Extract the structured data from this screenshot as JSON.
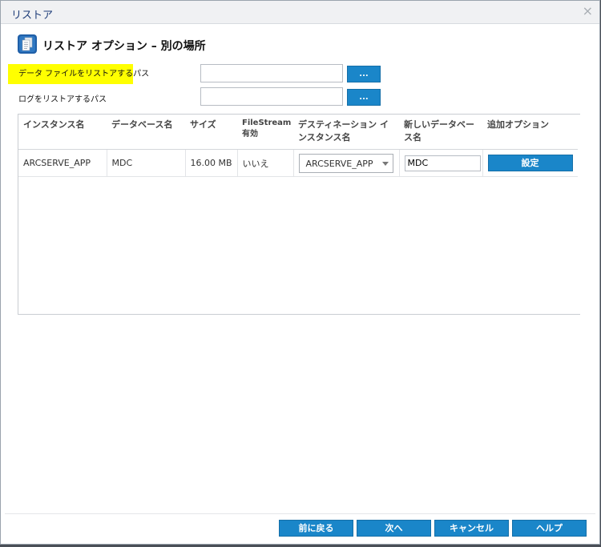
{
  "window": {
    "title": "リストア",
    "close_glyph": "×"
  },
  "header": {
    "icon": "document-icon",
    "title": "リストア オプション – 別の場所"
  },
  "paths": {
    "data_label": "データ ファイルをリストアするパス",
    "data_value": "",
    "log_label": "ログをリストアするパス",
    "log_value": "",
    "browse_label": "..."
  },
  "table": {
    "columns": [
      "インスタンス名",
      "データベース名",
      "サイズ",
      "FileStream 有効",
      "デスティネーション インスタンス名",
      "新しいデータベース名",
      "追加オプション"
    ],
    "rows": [
      {
        "instance": "ARCSERVE_APP",
        "database": "MDC",
        "size": "16.00 MB",
        "filestream": "いいえ",
        "dest_instance": "ARCSERVE_APP",
        "new_db_name": "MDC",
        "options_button": "設定"
      }
    ]
  },
  "footer": {
    "back": "前に戻る",
    "next": "次へ",
    "cancel": "キャンセル",
    "help": "ヘルプ"
  },
  "colors": {
    "accent": "#1a86c9",
    "highlight": "#ffff00",
    "title_text": "#1d3c78"
  }
}
